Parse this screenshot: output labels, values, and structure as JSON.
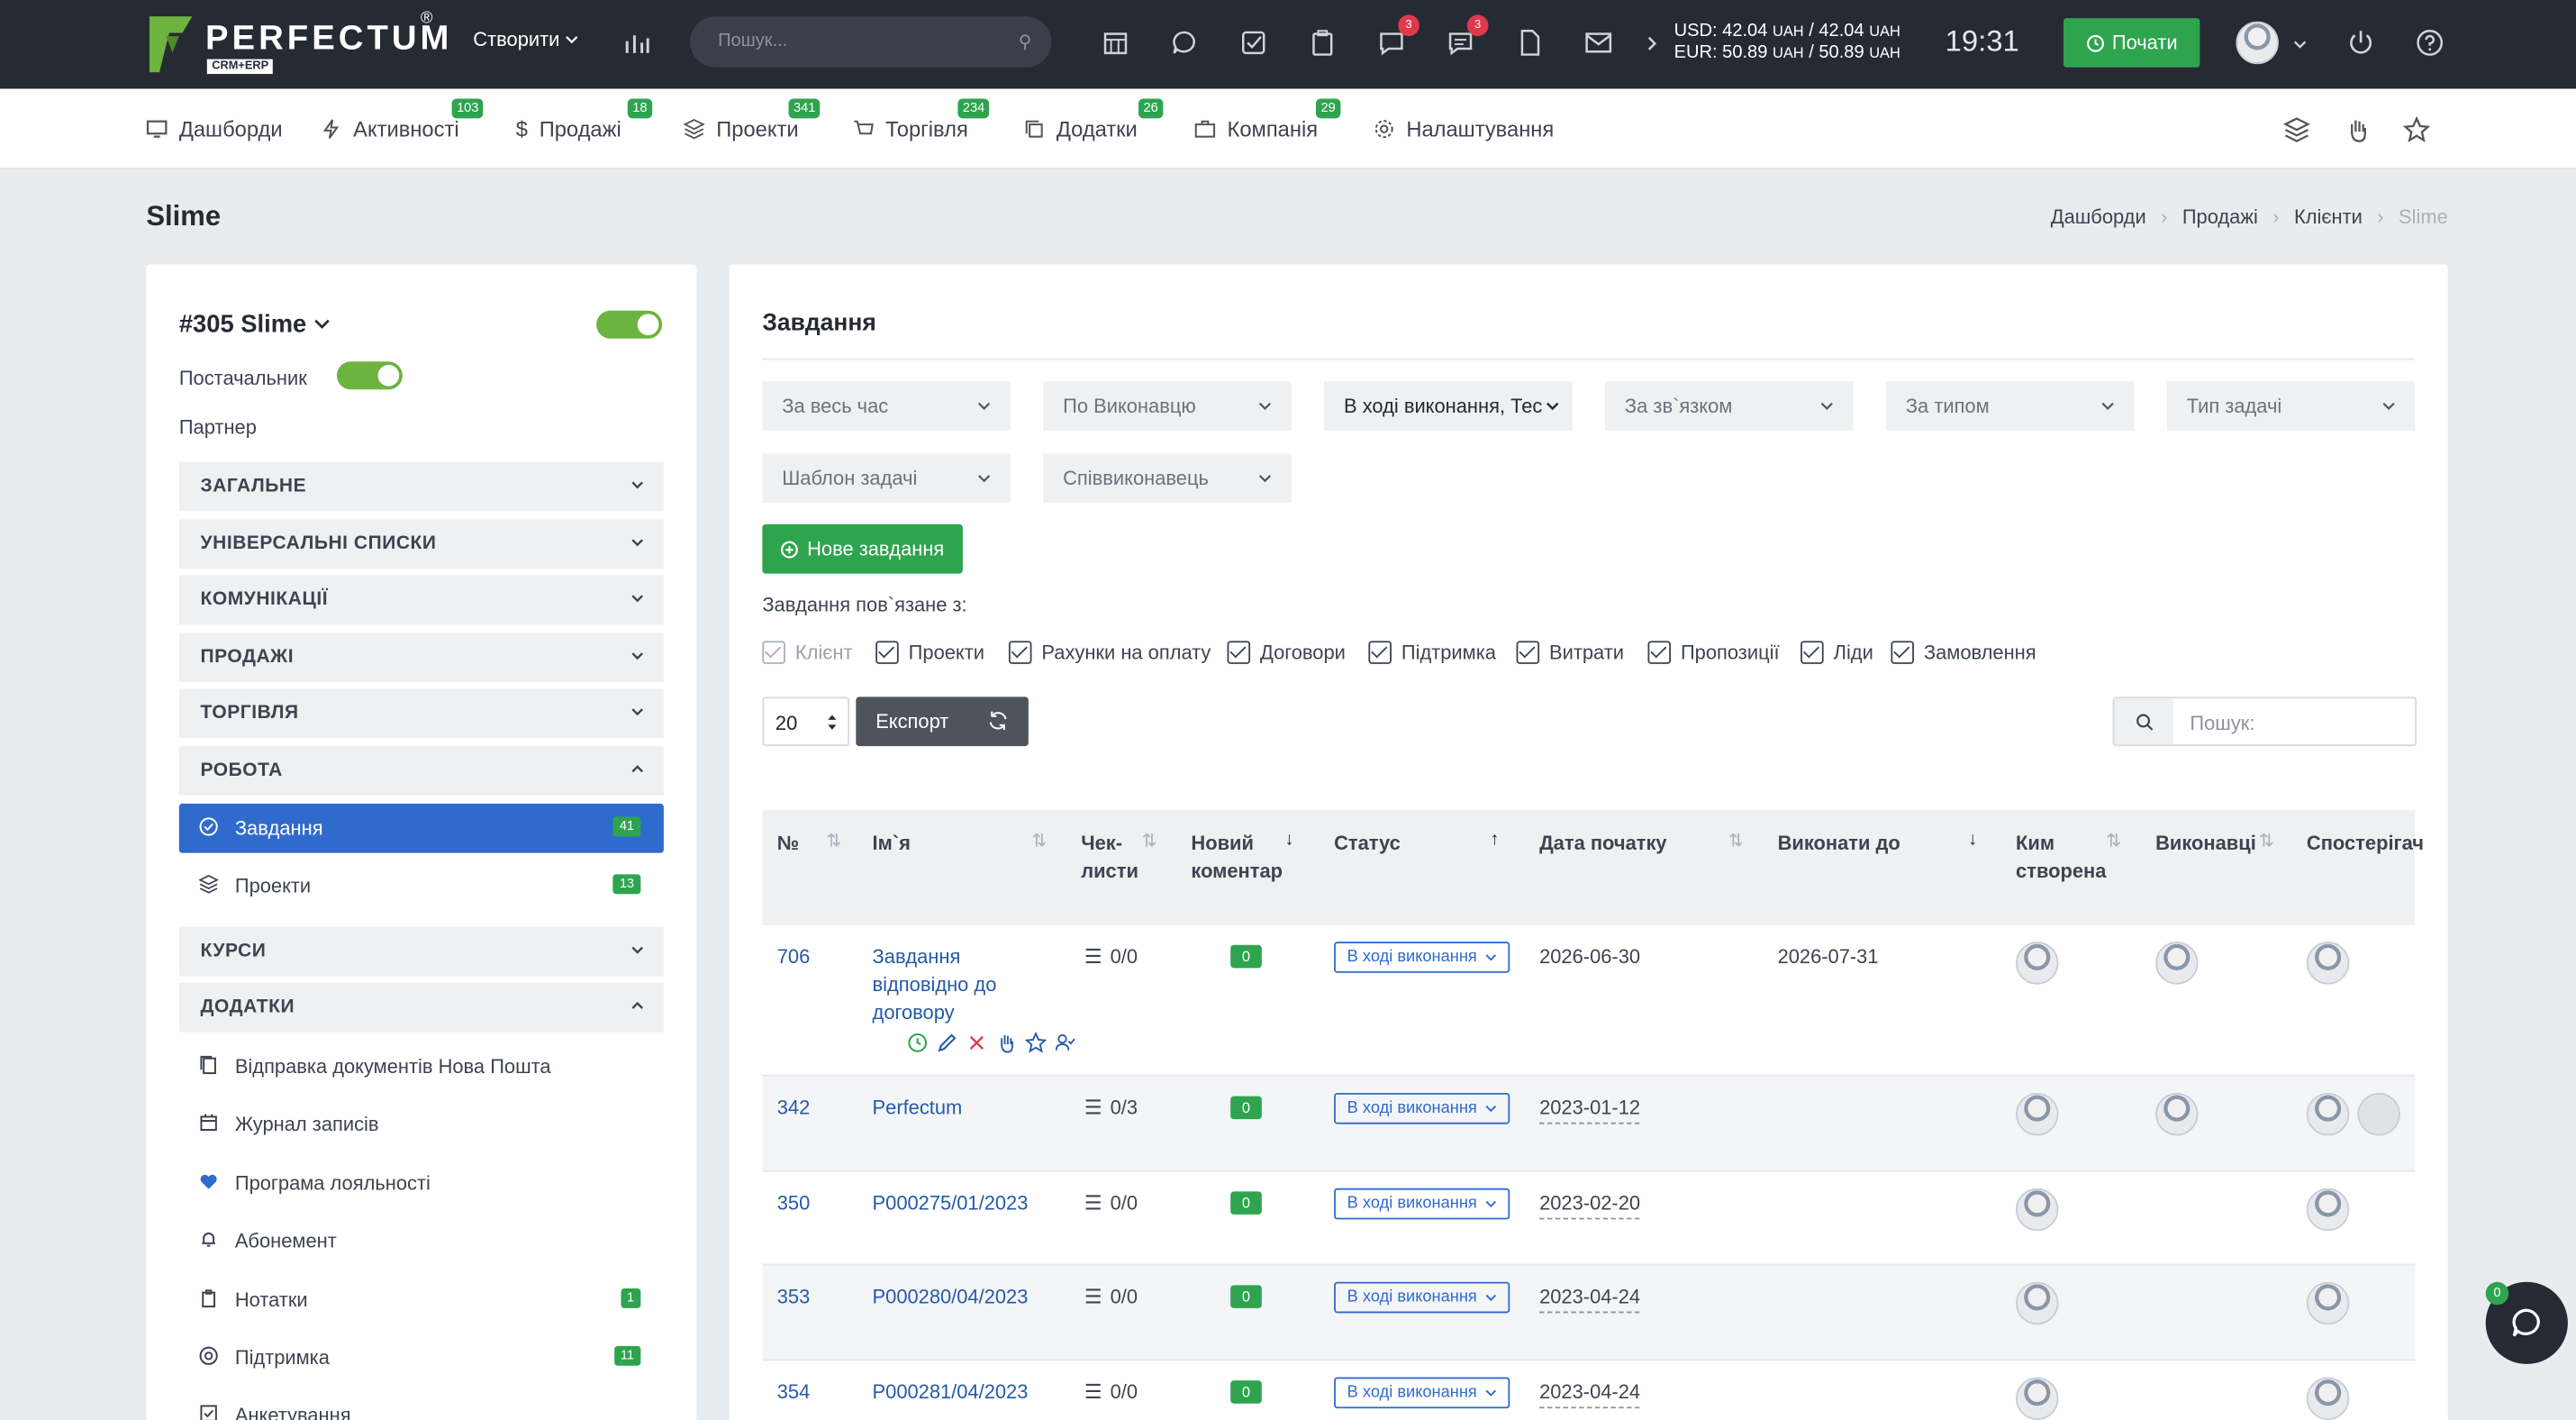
{
  "brand": {
    "name": "PERFECTUM",
    "sub": "CRM+ERP",
    "reg": "®"
  },
  "topbar": {
    "create_label": "Створити",
    "search_placeholder": "Пошук...",
    "chat_badge": "3",
    "messages_badge": "3",
    "rates": {
      "usd": "USD: 42.04",
      "usd2": "/ 42.04",
      "eur": "EUR: 50.89",
      "eur2": "/ 50.89",
      "unit": "UAH"
    },
    "time": "19:31",
    "start_label": "Почати"
  },
  "nav": [
    {
      "label": "Дашборди",
      "badge": ""
    },
    {
      "label": "Активності",
      "badge": "103"
    },
    {
      "label": "Продажі",
      "badge": "18"
    },
    {
      "label": "Проекти",
      "badge": "341"
    },
    {
      "label": "Торгівля",
      "badge": "234"
    },
    {
      "label": "Додатки",
      "badge": "26"
    },
    {
      "label": "Компанія",
      "badge": "29"
    },
    {
      "label": "Налаштування",
      "badge": ""
    }
  ],
  "page": {
    "title": "Slime",
    "breadcrumb": [
      "Дашборди",
      "Продажі",
      "Клієнти",
      "Slime"
    ]
  },
  "client": {
    "name": "#305 Slime",
    "supplier_label": "Постачальник",
    "partner_label": "Партнер"
  },
  "sections": {
    "general": "ЗАГАЛЬНЕ",
    "lists": "УНІВЕРСАЛЬНІ СПИСКИ",
    "comm": "КОМУНІКАЦІЇ",
    "sales": "ПРОДАЖІ",
    "trade": "ТОРГІВЛЯ",
    "work": "РОБОТА",
    "courses": "КУРСИ",
    "addons": "ДОДАТКИ"
  },
  "work_items": [
    {
      "label": "Завдання",
      "badge": "41"
    },
    {
      "label": "Проекти",
      "badge": "13"
    }
  ],
  "addon_items": [
    {
      "label": "Відправка документів Нова Пошта",
      "badge": ""
    },
    {
      "label": "Журнал записів",
      "badge": ""
    },
    {
      "label": "Програма лояльності",
      "badge": ""
    },
    {
      "label": "Абонемент",
      "badge": ""
    },
    {
      "label": "Нотатки",
      "badge": "1"
    },
    {
      "label": "Підтримка",
      "badge": "11"
    },
    {
      "label": "Анкетування",
      "badge": ""
    }
  ],
  "tasks": {
    "title": "Завдання",
    "filters": [
      "За весь час",
      "По Виконавцю",
      "В ході виконання, Тес",
      "За зв`язком",
      "За типом",
      "Тип задачі",
      "Шаблон задачі",
      "Співвиконавець"
    ],
    "new_task": "Нове завдання",
    "related_label": "Завдання пов`язане з:",
    "related": [
      "Клієнт",
      "Проекти",
      "Рахунки на оплату",
      "Договори",
      "Підтримка",
      "Витрати",
      "Пропозиції",
      "Ліди",
      "Замовлення"
    ],
    "page_size": "20",
    "export": "Експорт",
    "search_placeholder": "Пошук:",
    "columns": {
      "num": "№",
      "name": "Ім`я",
      "check1": "Чек-",
      "check2": "листи",
      "comment1": "Новий",
      "comment2": "коментар",
      "status": "Статус",
      "start": "Дата початку",
      "due": "Виконати до",
      "creator1": "Ким",
      "creator2": "створена",
      "executors": "Виконавці",
      "watchers": "Спостерігач"
    },
    "rows": [
      {
        "num": "706",
        "name": "Завдання відповідно до договору",
        "checklist": "0/0",
        "comments": "0",
        "status": "В ході виконання",
        "start": "2026-06-30",
        "due": "2026-07-31"
      },
      {
        "num": "342",
        "name": "Perfectum",
        "checklist": "0/3",
        "comments": "0",
        "status": "В ході виконання",
        "start": "2023-01-12",
        "due": ""
      },
      {
        "num": "350",
        "name": "P000275/01/2023",
        "checklist": "0/0",
        "comments": "0",
        "status": "В ході виконання",
        "start": "2023-02-20",
        "due": ""
      },
      {
        "num": "353",
        "name": "P000280/04/2023",
        "checklist": "0/0",
        "comments": "0",
        "status": "В ході виконання",
        "start": "2023-04-24",
        "due": ""
      },
      {
        "num": "354",
        "name": "P000281/04/2023",
        "checklist": "0/0",
        "comments": "0",
        "status": "В ході виконання",
        "start": "2023-04-24",
        "due": ""
      }
    ]
  },
  "chat": {
    "badge": "0"
  }
}
